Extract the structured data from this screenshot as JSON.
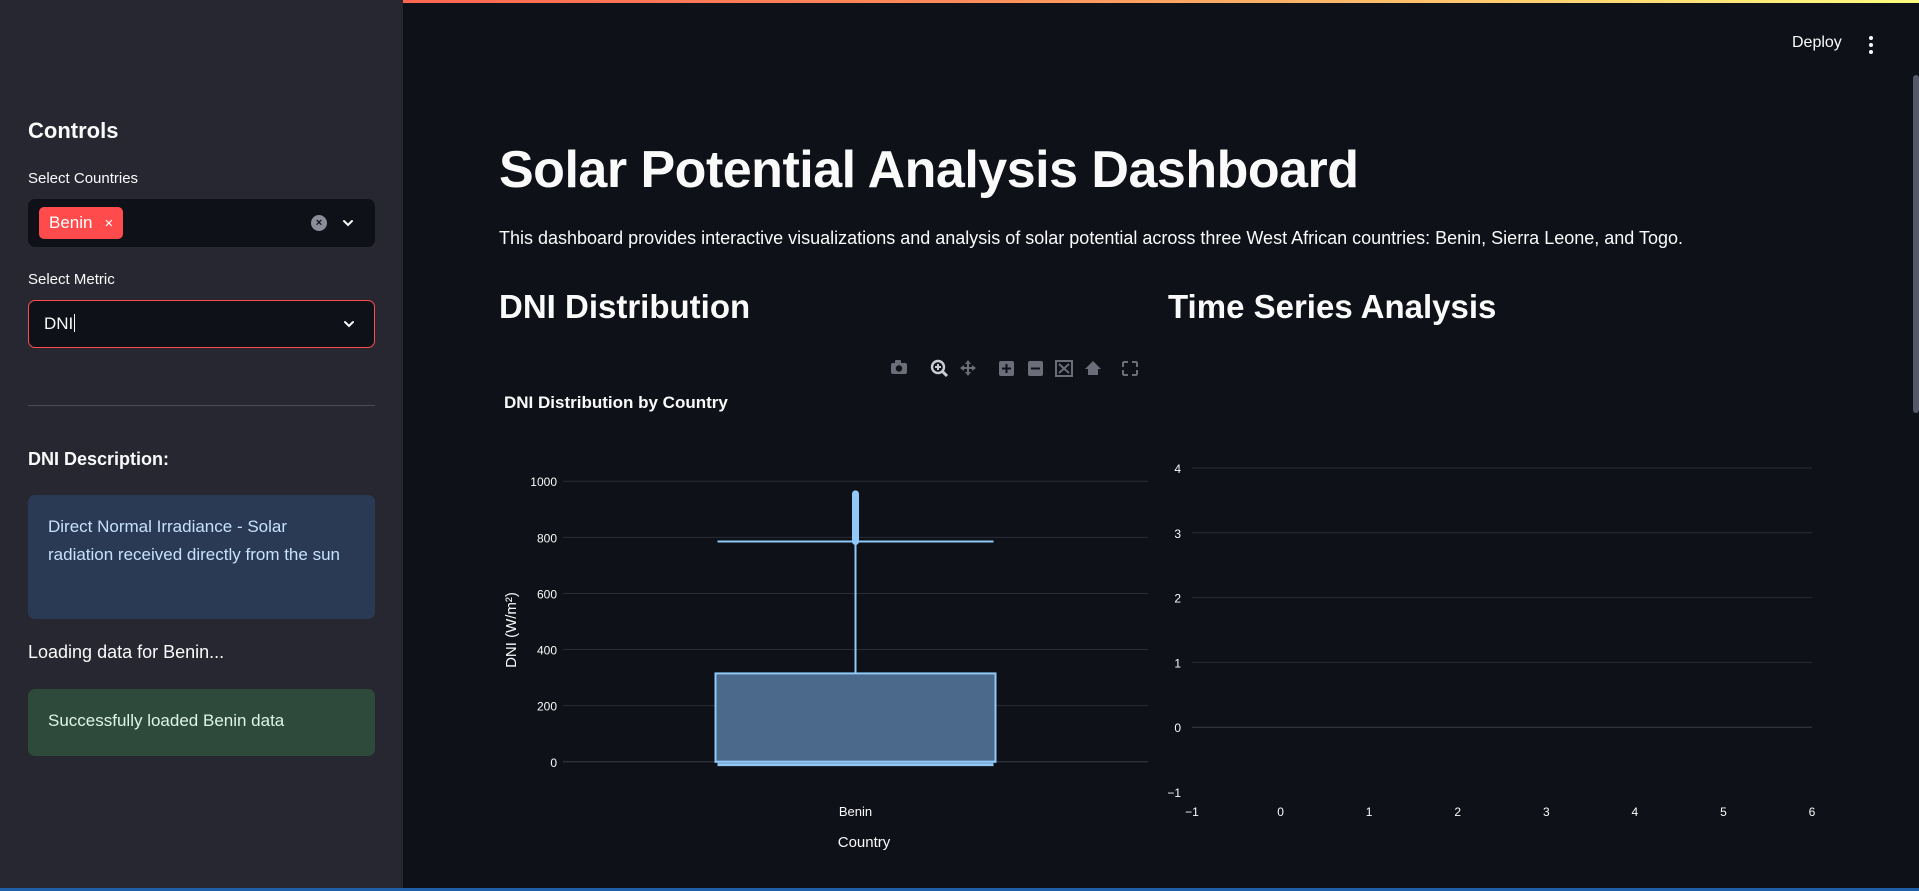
{
  "sidebar": {
    "heading": "Controls",
    "countries_label": "Select Countries",
    "selected_countries": [
      "Benin"
    ],
    "remove_tag_glyph": "×",
    "metric_label": "Select Metric",
    "metric_value": "DNI",
    "description_heading": "DNI Description:",
    "description_text": "Direct Normal Irradiance - Solar radiation received directly from the sun",
    "loading_text": "Loading data for Benin...",
    "success_text": "Successfully loaded Benin data"
  },
  "header": {
    "deploy_label": "Deploy"
  },
  "main": {
    "title": "Solar Potential Analysis Dashboard",
    "intro": "This dashboard provides interactive visualizations and analysis of solar potential across three West African countries: Benin, Sierra Leone, and Togo.",
    "left_heading": "DNI Distribution",
    "right_heading": "Time Series Analysis"
  },
  "colors": {
    "accent": "#ff4b4b",
    "box_fill": "#4b6a8b",
    "box_line": "#90c8f8"
  },
  "chart_data": [
    {
      "type": "box",
      "title": "DNI Distribution by Country",
      "xlabel": "Country",
      "ylabel": "DNI (W/m²)",
      "categories": [
        "Benin"
      ],
      "ylim": [
        -40,
        1040
      ],
      "yticks": [
        0,
        200,
        400,
        600,
        800,
        1000
      ],
      "series": [
        {
          "category": "Benin",
          "min": -10,
          "q1": 0,
          "median": 0,
          "q3": 315,
          "max": 785,
          "outliers_range": [
            785,
            955
          ]
        }
      ],
      "grid": true
    },
    {
      "type": "line",
      "title": "",
      "xlabel": "",
      "ylabel": "",
      "xlim": [
        -1,
        6
      ],
      "ylim": [
        -1,
        4
      ],
      "xticks": [
        "−1",
        "0",
        "1",
        "2",
        "3",
        "4",
        "5",
        "6"
      ],
      "yticks": [
        "−1",
        "0",
        "1",
        "2",
        "3",
        "4"
      ],
      "series": [],
      "grid": true
    }
  ]
}
